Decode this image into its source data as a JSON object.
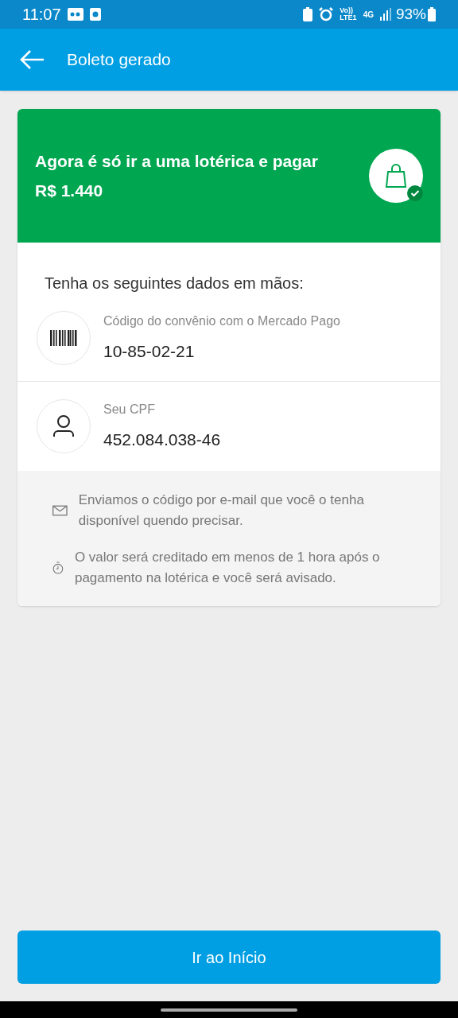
{
  "status_bar": {
    "time": "11:07",
    "volte": "Vo))",
    "lte": "LTE1",
    "network": "4G",
    "battery": "93%"
  },
  "app_bar": {
    "title": "Boleto gerado"
  },
  "banner": {
    "message": "Agora é só ir a uma lotérica e pagar",
    "amount": "R$ 1.440"
  },
  "details": {
    "heading": "Tenha os seguintes dados em mãos:",
    "items": [
      {
        "kind": "barcode",
        "label": "Código do convênio com o Mercado Pago",
        "value": "10-85-02-21"
      },
      {
        "kind": "person",
        "label": "Seu CPF",
        "value": "452.084.038-46"
      }
    ]
  },
  "notes": [
    {
      "kind": "mail",
      "text": "Enviamos o código por e-mail que você o tenha disponível quendo precisar."
    },
    {
      "kind": "timer",
      "text": "O valor será creditado em menos de 1 hora após o pagamento na lotérica e você será avisado."
    }
  ],
  "primary_button": "Ir ao Início"
}
